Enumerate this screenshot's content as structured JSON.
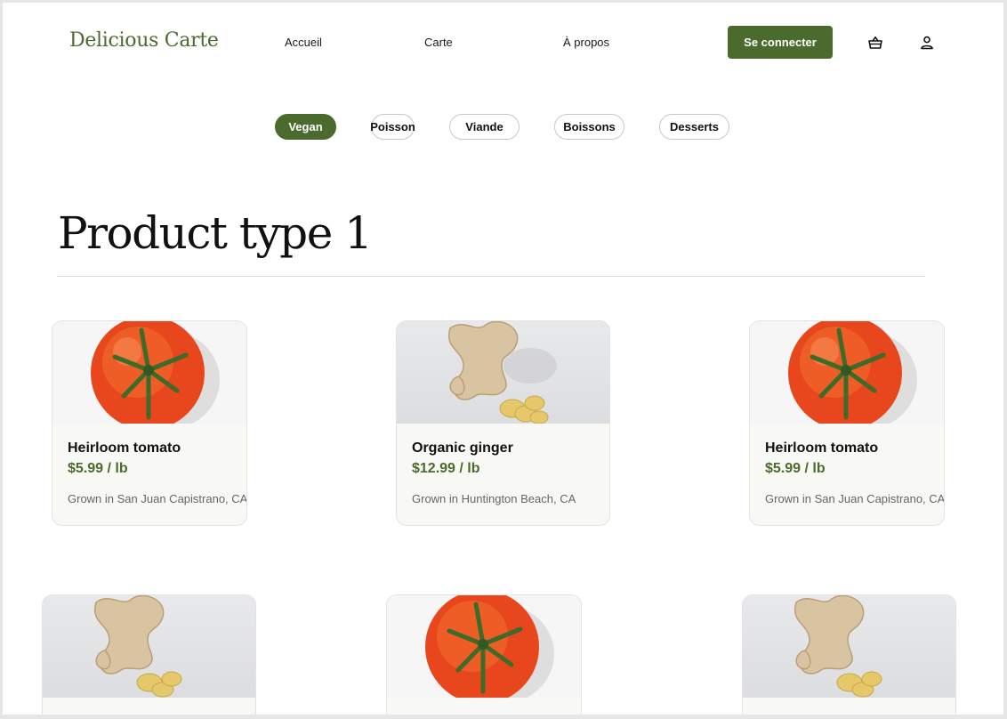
{
  "brand": {
    "name": "Delicious Carte",
    "accent": "#4a6b2d"
  },
  "nav": {
    "links": [
      "Accueil",
      "Carte",
      "À propos"
    ],
    "login_label": "Se connecter",
    "icons": [
      "basket-icon",
      "user-icon"
    ]
  },
  "filters": [
    {
      "label": "Vegan",
      "active": true
    },
    {
      "label": "Poisson",
      "active": false
    },
    {
      "label": "Viande",
      "active": false
    },
    {
      "label": "Boissons",
      "active": false
    },
    {
      "label": "Desserts",
      "active": false
    }
  ],
  "section": {
    "title": "Product type 1"
  },
  "products": [
    {
      "name": "Heirloom tomato",
      "price": "$5.99 / lb",
      "origin": "Grown in San Juan Capistrano, CA",
      "image": "tomato"
    },
    {
      "name": "Organic ginger",
      "price": "$12.99 / lb",
      "origin": "Grown in Huntington Beach, CA",
      "image": "ginger"
    },
    {
      "name": "Heirloom tomato",
      "price": "$5.99 / lb",
      "origin": "Grown in San Juan Capistrano, CA",
      "image": "tomato"
    },
    {
      "image": "ginger"
    },
    {
      "image": "tomato"
    },
    {
      "image": "ginger"
    }
  ]
}
